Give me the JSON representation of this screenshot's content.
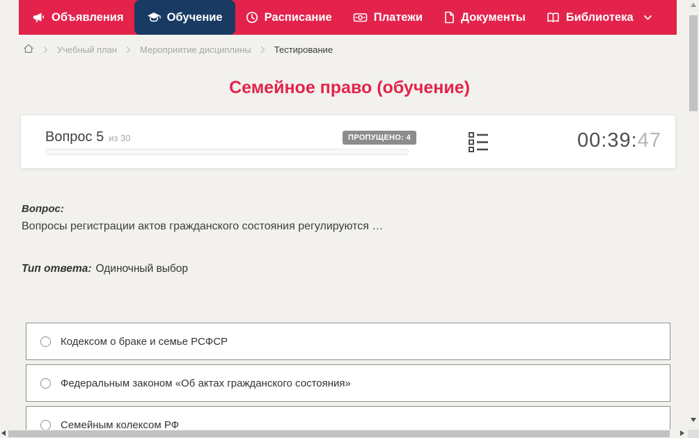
{
  "colors": {
    "accent_red": "#E3234B",
    "active_tab_navy": "#183A63",
    "page_background": "#F2F1ED",
    "badge_gray": "#8C8C8C"
  },
  "nav": {
    "items": [
      {
        "label": "Объявления",
        "icon": "megaphone-icon",
        "active": false
      },
      {
        "label": "Обучение",
        "icon": "graduation-cap-icon",
        "active": true
      },
      {
        "label": "Расписание",
        "icon": "clock-icon",
        "active": false
      },
      {
        "label": "Платежи",
        "icon": "banknote-icon",
        "active": false
      },
      {
        "label": "Документы",
        "icon": "document-icon",
        "active": false
      },
      {
        "label": "Библиотека",
        "icon": "book-icon",
        "active": false,
        "has_dropdown": true
      }
    ]
  },
  "breadcrumb": {
    "home_icon": "home-icon",
    "items": [
      "Учебный план",
      "Мероприятие дисциплины",
      "Тестирование"
    ]
  },
  "page": {
    "title": "Семейное право (обучение)"
  },
  "quiz": {
    "question_number_label": "Вопрос 5",
    "question_total_label": "из 30",
    "skipped_badge": "ПРОПУЩЕНО: 4",
    "timer": {
      "hours_minutes": "00:39:",
      "seconds": "47"
    },
    "progress_percent": 0,
    "question_heading": "Вопрос:",
    "question_text": "Вопросы регистрации актов гражданского состояния регулируются …",
    "answer_type_label": "Тип ответа:",
    "answer_type_value": "Одиночный выбор",
    "options": [
      {
        "label": "Кодексом о браке и семье РСФСР",
        "selected": false
      },
      {
        "label": "Федеральным законом «Об актах гражданского состояния»",
        "selected": false
      },
      {
        "label": "Семейным колексом РФ",
        "selected": false
      }
    ]
  }
}
